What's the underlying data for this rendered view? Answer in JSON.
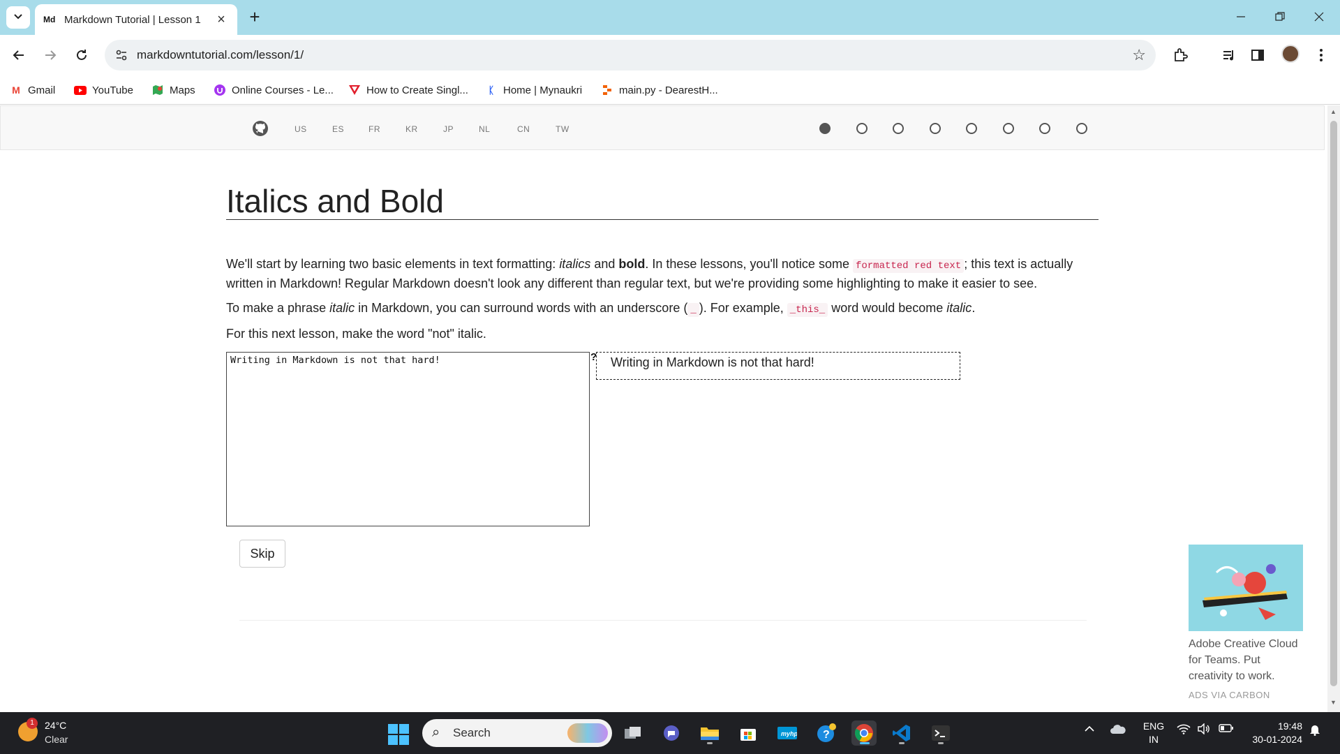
{
  "browser": {
    "tab_title": "Markdown Tutorial | Lesson 1",
    "tab_favicon_text": "Md",
    "url": "markdowntutorial.com/lesson/1/",
    "bookmarks": [
      {
        "label": "Gmail",
        "icon": "gmail-icon",
        "color": "#ea4335"
      },
      {
        "label": "YouTube",
        "icon": "youtube-icon",
        "color": "#ff0000"
      },
      {
        "label": "Maps",
        "icon": "maps-icon",
        "color": "#34a853"
      },
      {
        "label": "Online Courses - Le...",
        "icon": "udemy-icon",
        "color": "#a435f0"
      },
      {
        "label": "How to Create Singl...",
        "icon": "vercel-icon",
        "color": "#e11d2b"
      },
      {
        "label": "Home | Mynaukri",
        "icon": "naukri-icon",
        "color": "#275df5"
      },
      {
        "label": "main.py - DearestH...",
        "icon": "replit-icon",
        "color": "#f26207"
      }
    ]
  },
  "site": {
    "languages": [
      "US",
      "ES",
      "FR",
      "KR",
      "JP",
      "NL",
      "CN",
      "TW"
    ],
    "progress": {
      "total_steps": 8,
      "current_step": 1
    }
  },
  "lesson": {
    "title": "Italics and Bold",
    "p1": {
      "a": "We'll start by learning two basic elements in text formatting: ",
      "italics": "italics",
      "and": " and ",
      "bold": "bold",
      "b": ". In these lessons, you'll notice some ",
      "code": "formatted red text",
      "c": "; this text is actually written in Markdown! Regular Markdown doesn't look any different than regular text, but we're providing some highlighting to make it easier to see."
    },
    "p2": {
      "a": "To make a phrase ",
      "italic": "italic",
      "b": " in Markdown, you can surround words with an underscore (",
      "code1": "_",
      "c": "). For example, ",
      "code2": "_this_",
      "d": " word would become ",
      "italic2": "italic",
      "e": "."
    },
    "p3": "For this next lesson, make the word \"not\" italic.",
    "editor_value": "Writing in Markdown is not that hard!",
    "help_label": "?",
    "preview_text": "Writing in Markdown is not that hard!",
    "skip_label": "Skip"
  },
  "ad": {
    "text": "Adobe Creative Cloud for Teams. Put creativity to work.",
    "via": "ADS VIA CARBON"
  },
  "taskbar": {
    "weather_temp": "24°C",
    "weather_cond": "Clear",
    "weather_badge": "1",
    "search_label": "Search",
    "lang_line1": "ENG",
    "lang_line2": "IN",
    "time": "19:48",
    "date": "30-01-2024"
  }
}
